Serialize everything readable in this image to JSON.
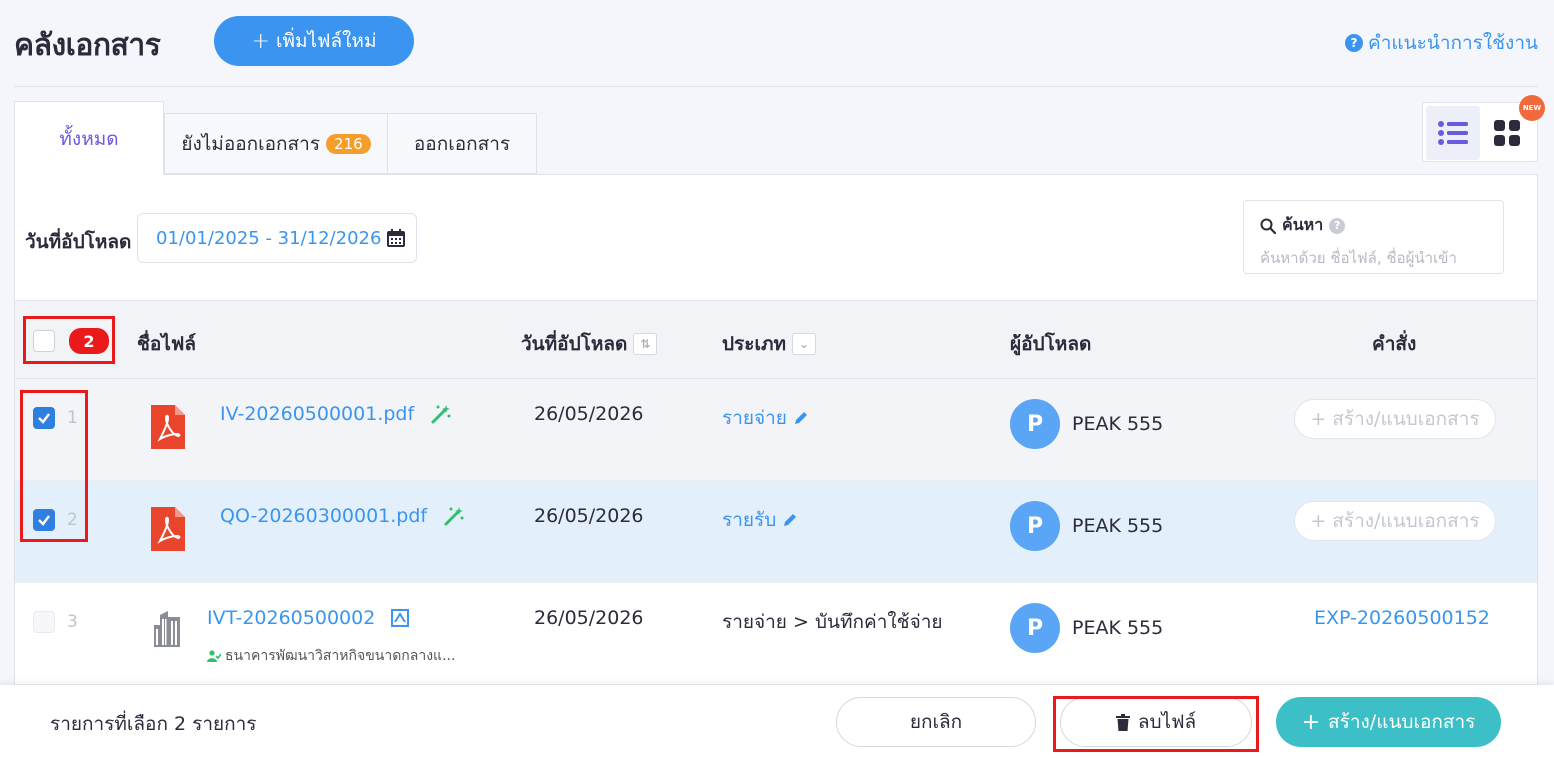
{
  "header": {
    "title": "คลังเอกสาร",
    "add_file_label": "เพิ่มไฟล์ใหม่",
    "help_label": "คำแนะนำการใช้งาน"
  },
  "tabs": [
    {
      "label": "ทั้งหมด",
      "active": true
    },
    {
      "label": "ยังไม่ออกเอกสาร",
      "badge": "216"
    },
    {
      "label": "ออกเอกสาร"
    }
  ],
  "view_toggle": {
    "new_badge": "NEW",
    "active": "list"
  },
  "filters": {
    "date_label": "วันที่อัปโหลด",
    "date_range": "01/01/2025 - 31/12/2026",
    "search_title": "ค้นหา",
    "search_placeholder": "ค้นหาด้วย ชื่อไฟล์, ชื่อผู้นำเข้า"
  },
  "table": {
    "selected_count": "2",
    "columns": {
      "file_name": "ชื่อไฟล์",
      "upload_date": "วันที่อัปโหลด",
      "type": "ประเภท",
      "uploader": "ผู้อัปโหลด",
      "action": "คำสั่ง"
    },
    "rows": [
      {
        "num": "1",
        "checked": true,
        "file_name": "IV-20260500001.pdf",
        "icon": "pdf-icon",
        "date": "26/05/2026",
        "type": "รายจ่าย",
        "avatar": "P",
        "uploader": "PEAK 555",
        "action": "สร้าง/แนบเอกสาร"
      },
      {
        "num": "2",
        "checked": true,
        "file_name": "QO-20260300001.pdf",
        "icon": "pdf-icon",
        "date": "26/05/2026",
        "type": "รายรับ",
        "avatar": "P",
        "uploader": "PEAK 555",
        "action": "สร้าง/แนบเอกสาร"
      },
      {
        "num": "3",
        "checked": false,
        "file_name": "IVT-20260500002",
        "icon": "building-icon",
        "sub_text": "ธนาคารพัฒนาวิสาหกิจขนาดกลางแ...",
        "date": "26/05/2026",
        "type": "รายจ่าย > บันทึกค่าใช้จ่าย",
        "avatar": "P",
        "uploader": "PEAK 555",
        "action": "EXP-20260500152"
      }
    ]
  },
  "bottom_bar": {
    "selection_text": "รายการที่เลือก 2 รายการ",
    "cancel_label": "ยกเลิก",
    "delete_label": "ลบไฟล์",
    "create_label": "สร้าง/แนบเอกสาร"
  },
  "colors": {
    "primary": "#3b95f0",
    "accent_purple": "#6a5ae0",
    "badge_orange": "#f59e2b",
    "highlight_red": "#ea1a1a",
    "teal": "#3cbfc6",
    "pdf_red": "#e8452c"
  }
}
